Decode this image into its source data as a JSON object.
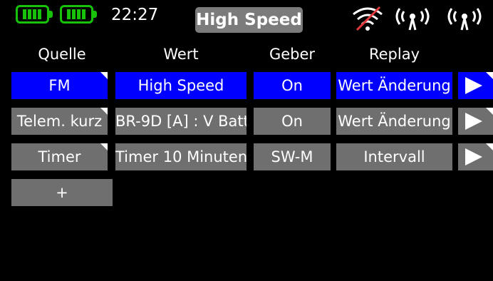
{
  "status": {
    "time": "22:27",
    "model_name": "High Speed",
    "icons": [
      "battery-transmitter-icon",
      "battery-receiver-icon",
      "no-signal-icon",
      "antenna-signal-icon",
      "antenna-signal-icon"
    ],
    "accent_color": "#19c20a",
    "signal_off_color": "#e23a3a"
  },
  "columns": {
    "quelle": "Quelle",
    "wert": "Wert",
    "geber": "Geber",
    "replay": "Replay"
  },
  "rows": [
    {
      "quelle": "FM",
      "wert": "High Speed",
      "geber": "On",
      "replay": "Wert Änderung",
      "selected": true
    },
    {
      "quelle": "Telem. kurz",
      "wert": "BR-9D [A] : V Batt",
      "geber": "On",
      "replay": "Wert Änderung",
      "selected": false
    },
    {
      "quelle": "Timer",
      "wert": "Timer 10 Minuten",
      "geber": "SW-M",
      "replay": "Intervall",
      "selected": false
    }
  ],
  "add_label": "+",
  "colors": {
    "selected_row": "#0000fe",
    "row": "#6f6f6f",
    "background": "#000000"
  }
}
